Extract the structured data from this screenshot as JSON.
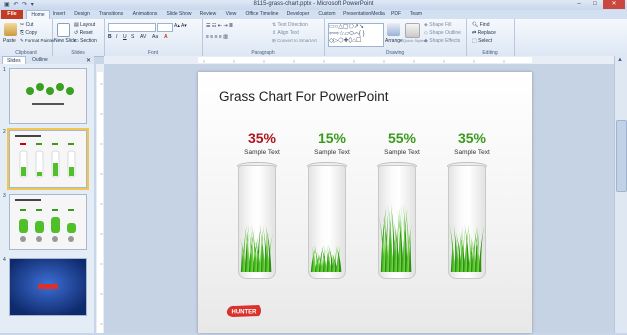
{
  "window": {
    "title": "8115-grass-chart.pptx - Microsoft PowerPoint",
    "controls": [
      "–",
      "□",
      "✕"
    ]
  },
  "tabs": [
    "File",
    "Home",
    "Insert",
    "Design",
    "Transitions",
    "Animations",
    "Slide Show",
    "Review",
    "View",
    "Office Timeline",
    "Developer",
    "Custom",
    "PresentationMedia",
    "PDF",
    "Team"
  ],
  "active_tab": "Home",
  "ribbon": {
    "clipboard": {
      "label": "Clipboard",
      "paste": "Paste",
      "cut": "Cut",
      "copy": "Copy",
      "format_painter": "Format Painter"
    },
    "slides": {
      "label": "Slides",
      "new_slide": "New Slide",
      "layout": "Layout",
      "reset": "Reset",
      "section": "Section"
    },
    "font": {
      "label": "Font"
    },
    "paragraph": {
      "label": "Paragraph",
      "text_direction": "Text Direction",
      "align_text": "Align Text",
      "convert": "Convert to SmartArt"
    },
    "drawing": {
      "label": "Drawing",
      "arrange": "Arrange",
      "quick_styles": "Quick Styles",
      "shape_fill": "Shape Fill",
      "shape_outline": "Shape Outline",
      "shape_effects": "Shape Effects"
    },
    "editing": {
      "label": "Editing",
      "find": "Find",
      "replace": "Replace",
      "select": "Select"
    }
  },
  "panel": {
    "tabs": [
      "Slides",
      "Outline"
    ],
    "thumb_numbers": [
      "1",
      "2",
      "3",
      "4"
    ],
    "thumb_title": "Grass Chart For PowerPoint"
  },
  "slide": {
    "title": "Grass Chart For PowerPoint",
    "logo": "HUNTER",
    "items": [
      {
        "percent": "35%",
        "label": "Sample Text",
        "color": "#b0141e",
        "level": 0.35
      },
      {
        "percent": "15%",
        "label": "Sample Text",
        "color": "#3a9a1c",
        "level": 0.15
      },
      {
        "percent": "55%",
        "label": "Sample Text",
        "color": "#3a9a1c",
        "level": 0.55
      },
      {
        "percent": "35%",
        "label": "Sample Text",
        "color": "#3a9a1c",
        "level": 0.35
      }
    ]
  },
  "colors": {
    "file_tab": "#c23b22",
    "grass": "#4fbf2a",
    "selected_thumb": "#f3c650"
  }
}
